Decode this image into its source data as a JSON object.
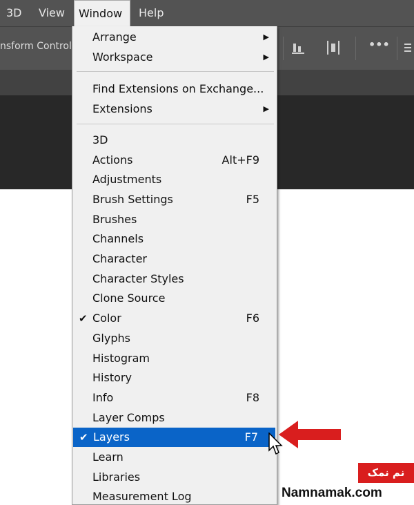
{
  "menubar": {
    "items": [
      "3D",
      "View",
      "Window",
      "Help"
    ]
  },
  "optionsbar": {
    "transform_text": "nsform Controls",
    "icons": [
      "align-bottom-icon",
      "distribute-icon",
      "more-icon",
      "settings-icon"
    ],
    "more_label": "•••"
  },
  "window_menu": {
    "section1": [
      {
        "label": "Arrange",
        "submenu": true
      },
      {
        "label": "Workspace",
        "submenu": true
      }
    ],
    "section2": [
      {
        "label": "Find Extensions on Exchange..."
      },
      {
        "label": "Extensions",
        "submenu": true
      }
    ],
    "section3": [
      {
        "label": "3D"
      },
      {
        "label": "Actions",
        "shortcut": "Alt+F9"
      },
      {
        "label": "Adjustments"
      },
      {
        "label": "Brush Settings",
        "shortcut": "F5"
      },
      {
        "label": "Brushes"
      },
      {
        "label": "Channels"
      },
      {
        "label": "Character"
      },
      {
        "label": "Character Styles"
      },
      {
        "label": "Clone Source"
      },
      {
        "label": "Color",
        "shortcut": "F6",
        "checked": true
      },
      {
        "label": "Glyphs"
      },
      {
        "label": "Histogram"
      },
      {
        "label": "History"
      },
      {
        "label": "Info",
        "shortcut": "F8"
      },
      {
        "label": "Layer Comps"
      },
      {
        "label": "Layers",
        "shortcut": "F7",
        "checked": true,
        "highlighted": true
      },
      {
        "label": "Learn"
      },
      {
        "label": "Libraries"
      },
      {
        "label": "Measurement Log"
      }
    ],
    "check_glyph": "✔",
    "arrow_glyph": "▶"
  },
  "watermark": {
    "persian": "نم نمک",
    "english": "Namnamak.com"
  },
  "colors": {
    "menubar": "#535353",
    "highlight": "#0a64c8",
    "arrow": "#d91e1e"
  }
}
